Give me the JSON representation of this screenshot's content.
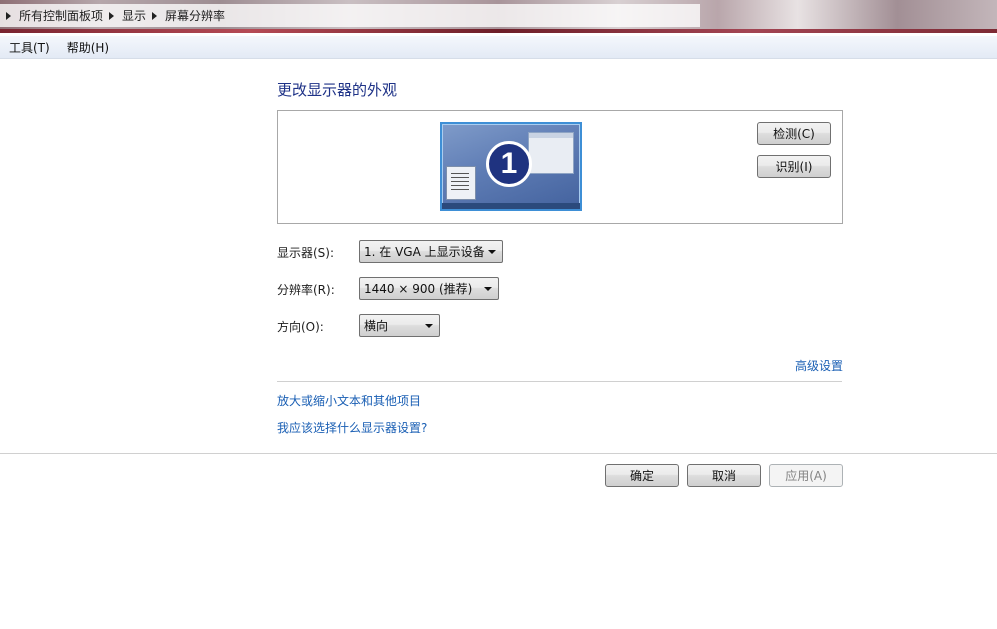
{
  "breadcrumb": [
    "所有控制面板项",
    "显示",
    "屏幕分辨率"
  ],
  "menu": {
    "tools": "工具(T)",
    "help": "帮助(H)"
  },
  "heading": "更改显示器的外观",
  "monitor": {
    "number": "1"
  },
  "buttons": {
    "detect": "检测(C)",
    "identify": "识别(I)",
    "ok": "确定",
    "cancel": "取消",
    "apply": "应用(A)"
  },
  "fields": {
    "display": {
      "label": "显示器(S):",
      "value": "1. 在 VGA 上显示设备"
    },
    "resolution": {
      "label": "分辨率(R):",
      "value": "1440 × 900 (推荐)"
    },
    "orientation": {
      "label": "方向(O):",
      "value": "横向"
    }
  },
  "links": {
    "advanced": "高级设置",
    "text_size": "放大或缩小文本和其他项目",
    "which_settings": "我应该选择什么显示器设置?"
  }
}
